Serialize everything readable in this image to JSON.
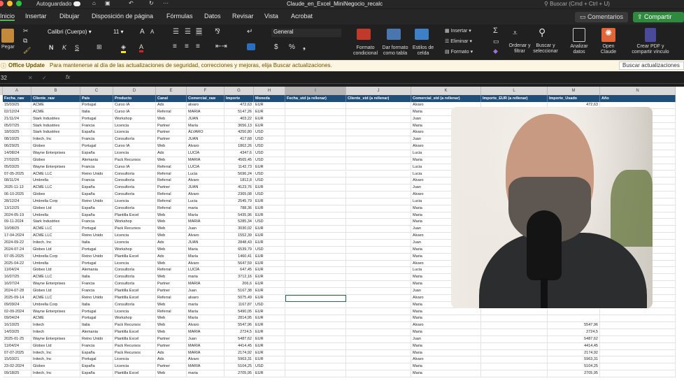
{
  "window": {
    "autosave_label": "Autoguardado",
    "filename": "Claude_en_Excel_MiniNegocio_recalc",
    "search_placeholder": "Buscar (Cmd + Ctrl + U)"
  },
  "tabs": [
    "Inicio",
    "Insertar",
    "Dibujar",
    "Disposición de página",
    "Fórmulas",
    "Datos",
    "Revisar",
    "Vista",
    "Acrobat"
  ],
  "buttons": {
    "comments": "Comentarios",
    "share": "Compartir"
  },
  "ribbon": {
    "paste": "Pegar",
    "font_name": "Calibri (Cuerpo)",
    "font_size": "11",
    "bold": "N",
    "italic": "K",
    "underline": "S",
    "number_format": "General",
    "conditional": "Formato condicional",
    "as_table": "Dar formato como tabla",
    "cell_styles": "Estilos de celda",
    "insert": "Insertar",
    "delete": "Eliminar",
    "format": "Formato",
    "sort": "Ordenar y filtrar",
    "find": "Buscar y seleccionar",
    "analyze": "Analizar datos",
    "claude": "Open Claude",
    "pdf": "Crear PDF y compartir vínculo"
  },
  "update_bar": {
    "title": "Office Update",
    "message": "Para mantenerse al día de las actualizaciones de seguridad, correcciones y mejoras, elija Buscar actualizaciones.",
    "button": "Buscar actualizaciones"
  },
  "formula_bar": {
    "name_box": "32",
    "fx": "fx"
  },
  "columns": [
    "A",
    "B",
    "C",
    "D",
    "E",
    "F",
    "G",
    "H",
    "I",
    "J",
    "K",
    "L",
    "M",
    "N"
  ],
  "headers": [
    "Fecha_raw",
    "Cliente_raw",
    "País",
    "Producto",
    "Canal",
    "Comercial_raw",
    "Importe",
    "Moneda",
    "Fecha_std (a rellenar)",
    "Cliente_std (a rellenar)",
    "Comercial_std (a rellenar)",
    "Importe_EUR (a rellenar)",
    "Importe_Usado",
    "Año"
  ],
  "rows": [
    [
      "15/03/25",
      "ACME",
      "Portugal",
      "Curso IA",
      "Ads",
      "alvaro",
      "472,63",
      "EUR",
      "",
      "",
      "Alvaro",
      "",
      "472,63",
      ""
    ],
    [
      "02/12/24",
      "ACME",
      "Italia",
      "Curso IA",
      "Referral",
      "MARIA",
      "5147,26",
      "EUR",
      "",
      "",
      "Maria",
      "",
      "",
      ""
    ],
    [
      "21/11/24",
      "Stark Industries",
      "Portugal",
      "Workshop",
      "Web",
      "JUAN",
      "403,22",
      "EUR",
      "",
      "",
      "Juan",
      "",
      "",
      ""
    ],
    [
      "05/07/25",
      "Stark Industries",
      "Francia",
      "Licencia",
      "Partner",
      "María",
      "3656,13",
      "EUR",
      "",
      "",
      "Maria",
      "",
      "",
      ""
    ],
    [
      "18/03/25",
      "Stark Industries",
      "España",
      "Licencia",
      "Partner",
      "ÁLVARO",
      "4250,80",
      "USD",
      "",
      "",
      "Alvaro",
      "",
      "",
      ""
    ],
    [
      "08/10/25",
      "Initech, Inc",
      "Francia",
      "Consultoría",
      "Partner",
      "JUAN",
      "417,68",
      "USD",
      "",
      "",
      "Juan",
      "",
      "",
      ""
    ],
    [
      "06/29/25",
      "Globex",
      "Portugal",
      "Curso IA",
      "Web",
      "Alvaro",
      "1862,26",
      "USD",
      "",
      "",
      "Alvaro",
      "",
      "",
      ""
    ],
    [
      "14/08/24",
      "Wayne Enterprises",
      "España",
      "Licencia",
      "Ads",
      "LUCÍA",
      "4347,6",
      "USD",
      "",
      "",
      "Lucia",
      "",
      "",
      ""
    ],
    [
      "27/02/25",
      "Globex",
      "Alemania",
      "Pack Recursos",
      "Web",
      "MARIA",
      "4565,45",
      "USD",
      "",
      "",
      "Maria",
      "",
      "",
      ""
    ],
    [
      "05/03/25",
      "Wayne Enterprises",
      "Francia",
      "Curso IA",
      "Referral",
      "LUCIA",
      "1142,73",
      "EUR",
      "",
      "",
      "Lucia",
      "",
      "",
      ""
    ],
    [
      "07-05-2025",
      "ACME LLC",
      "Reino Unido",
      "Consultoría",
      "Referral",
      "Lucia",
      "5696,24",
      "USD",
      "",
      "",
      "Lucia",
      "",
      "",
      ""
    ],
    [
      "08/11/24",
      "Umbrella",
      "Francia",
      "Consultoría",
      "Referral",
      "Alvaro",
      "1812,8",
      "USD",
      "",
      "",
      "Alvaro",
      "",
      "",
      ""
    ],
    [
      "2025-11-13",
      "ACME LLC",
      "España",
      "Consultoría",
      "Partner",
      "JUAN",
      "4123,76",
      "EUR",
      "",
      "",
      "Juan",
      "",
      "",
      ""
    ],
    [
      "06-10-2025",
      "Globex",
      "España",
      "Consultoría",
      "Referral",
      "Alvaro",
      "2365,08",
      "USD",
      "",
      "",
      "Alvaro",
      "",
      "",
      ""
    ],
    [
      "28/12/24",
      "Umbrella Corp",
      "Reino Unido",
      "Licencia",
      "Referral",
      "Lucia",
      "2545,79",
      "EUR",
      "",
      "",
      "Lucia",
      "",
      "",
      ""
    ],
    [
      "13/12/25",
      "Globex Ltd",
      "España",
      "Consultoría",
      "Referral",
      "maria",
      "788,36",
      "EUR",
      "",
      "",
      "Maria",
      "",
      "",
      ""
    ],
    [
      "2024-05-19",
      "Umbrella",
      "España",
      "Plantilla Excel",
      "Web",
      "María",
      "5435,96",
      "EUR",
      "",
      "",
      "Maria",
      "",
      "",
      ""
    ],
    [
      "09-11-2024",
      "Stark Industries",
      "Francia",
      "Workshop",
      "Web",
      "MARIA",
      "5285,34",
      "USD",
      "",
      "",
      "Maria",
      "",
      "",
      ""
    ],
    [
      "10/08/25",
      "ACME LLC",
      "Portugal",
      "Pack Recursos",
      "Web",
      "Juan",
      "3030,02",
      "EUR",
      "",
      "",
      "Juan",
      "",
      "",
      ""
    ],
    [
      "17-04-2024",
      "ACME LLC",
      "Reino Unido",
      "Licencia",
      "Web",
      "Alvaro",
      "1552,39",
      "EUR",
      "",
      "",
      "Alvaro",
      "",
      "",
      ""
    ],
    [
      "2024-09-22",
      "Initech, Inc",
      "Italia",
      "Licencia",
      "Ads",
      "JUAN",
      "2848,43",
      "EUR",
      "",
      "",
      "Juan",
      "",
      "",
      ""
    ],
    [
      "2024-07-24",
      "Globex Ltd",
      "Portugal",
      "Workshop",
      "Web",
      "Maria",
      "6539,79",
      "USD",
      "",
      "",
      "Maria",
      "",
      "",
      ""
    ],
    [
      "07-05-2025",
      "Umbrella Corp",
      "Reino Unido",
      "Plantilla Excel",
      "Ads",
      "María",
      "1460,41",
      "EUR",
      "",
      "",
      "Maria",
      "",
      "",
      ""
    ],
    [
      "2025-04-22",
      "Umbrella",
      "Portugal",
      "Licencia",
      "Web",
      "Alvaro",
      "5647,59",
      "EUR",
      "",
      "",
      "Alvaro",
      "",
      "",
      ""
    ],
    [
      "11/04/24",
      "Globex Ltd",
      "Alemania",
      "Consultoría",
      "Referral",
      "LUCÍA",
      "647,45",
      "EUR",
      "",
      "",
      "Lucia",
      "",
      "",
      ""
    ],
    [
      "16/07/25",
      "ACME LLC",
      "Italia",
      "Consultoría",
      "Web",
      "maria",
      "3712,16",
      "EUR",
      "",
      "",
      "Maria",
      "",
      "",
      ""
    ],
    [
      "16/07/24",
      "Wayne Enterprises",
      "Francia",
      "Consultoría",
      "Partner",
      "MARIA",
      "206,6",
      "EUR",
      "",
      "",
      "Maria",
      "",
      "",
      ""
    ],
    [
      "2024-07-28",
      "Globex Ltd",
      "Francia",
      "Plantilla Excel",
      "Partner",
      "Juan",
      "5167,38",
      "EUR",
      "",
      "",
      "Juan",
      "",
      "",
      ""
    ],
    [
      "2025-09-14",
      "ACME LLC",
      "Reino Unido",
      "Plantilla Excel",
      "Referral",
      "alvaro",
      "5075,49",
      "EUR",
      "",
      "",
      "Alvaro",
      "",
      "",
      ""
    ],
    [
      "09/09/24",
      "Umbrella Corp",
      "Italia",
      "Consultoría",
      "Web",
      "maría",
      "1167,87",
      "USD",
      "",
      "",
      "Maria",
      "",
      "",
      ""
    ],
    [
      "02-09-2024",
      "Wayne Enterprises",
      "Portugal",
      "Licencia",
      "Referral",
      "María",
      "5490,05",
      "EUR",
      "",
      "",
      "Maria",
      "",
      "",
      ""
    ],
    [
      "09/04/24",
      "ACME",
      "Portugal",
      "Workshop",
      "Web",
      "María",
      "2814,95",
      "EUR",
      "",
      "",
      "Maria",
      "",
      "",
      ""
    ],
    [
      "16/10/25",
      "Initech",
      "Italia",
      "Pack Recursos",
      "Web",
      "Alvaro",
      "5547,96",
      "EUR",
      "",
      "",
      "Alvaro",
      "",
      "5547,96",
      ""
    ],
    [
      "14/03/25",
      "Initech",
      "Alemania",
      "Plantilla Excel",
      "Web",
      "MARIA",
      "2724,5",
      "EUR",
      "",
      "",
      "Maria",
      "",
      "2724,5",
      ""
    ],
    [
      "2025-01-25",
      "Wayne Enterprises",
      "Reino Unido",
      "Plantilla Excel",
      "Partner",
      "Juan",
      "5487,62",
      "EUR",
      "",
      "",
      "Juan",
      "",
      "5487,62",
      ""
    ],
    [
      "11/04/24",
      "Globex Ltd",
      "Francia",
      "Pack Recursos",
      "Partner",
      "MARIA",
      "4414,45",
      "EUR",
      "",
      "",
      "Maria",
      "",
      "4414,45",
      ""
    ],
    [
      "07-07-2025",
      "Initech, Inc",
      "España",
      "Pack Recursos",
      "Ads",
      "MARIA",
      "2174,92",
      "EUR",
      "",
      "",
      "Maria",
      "",
      "2174,92",
      ""
    ],
    [
      "15/03/21",
      "Initech, Inc",
      "Portugal",
      "Licencia",
      "Ads",
      "Alvaro",
      "5963,31",
      "EUR",
      "",
      "",
      "Alvaro",
      "",
      "5963,31",
      ""
    ],
    [
      "23-02-2024",
      "Globex",
      "España",
      "Licencia",
      "Partner",
      "MARIA",
      "5104,25",
      "USD",
      "",
      "",
      "Maria",
      "",
      "5104,25",
      ""
    ],
    [
      "09/18/25",
      "Initech, Inc",
      "España",
      "Plantilla Excel",
      "Web",
      "maria",
      "2705,95",
      "EUR",
      "",
      "",
      "Maria",
      "",
      "2705,95",
      ""
    ]
  ],
  "colors": {
    "header_fill": "#1f4e78",
    "share_green": "#2e8b3e",
    "accent": "#217346"
  }
}
